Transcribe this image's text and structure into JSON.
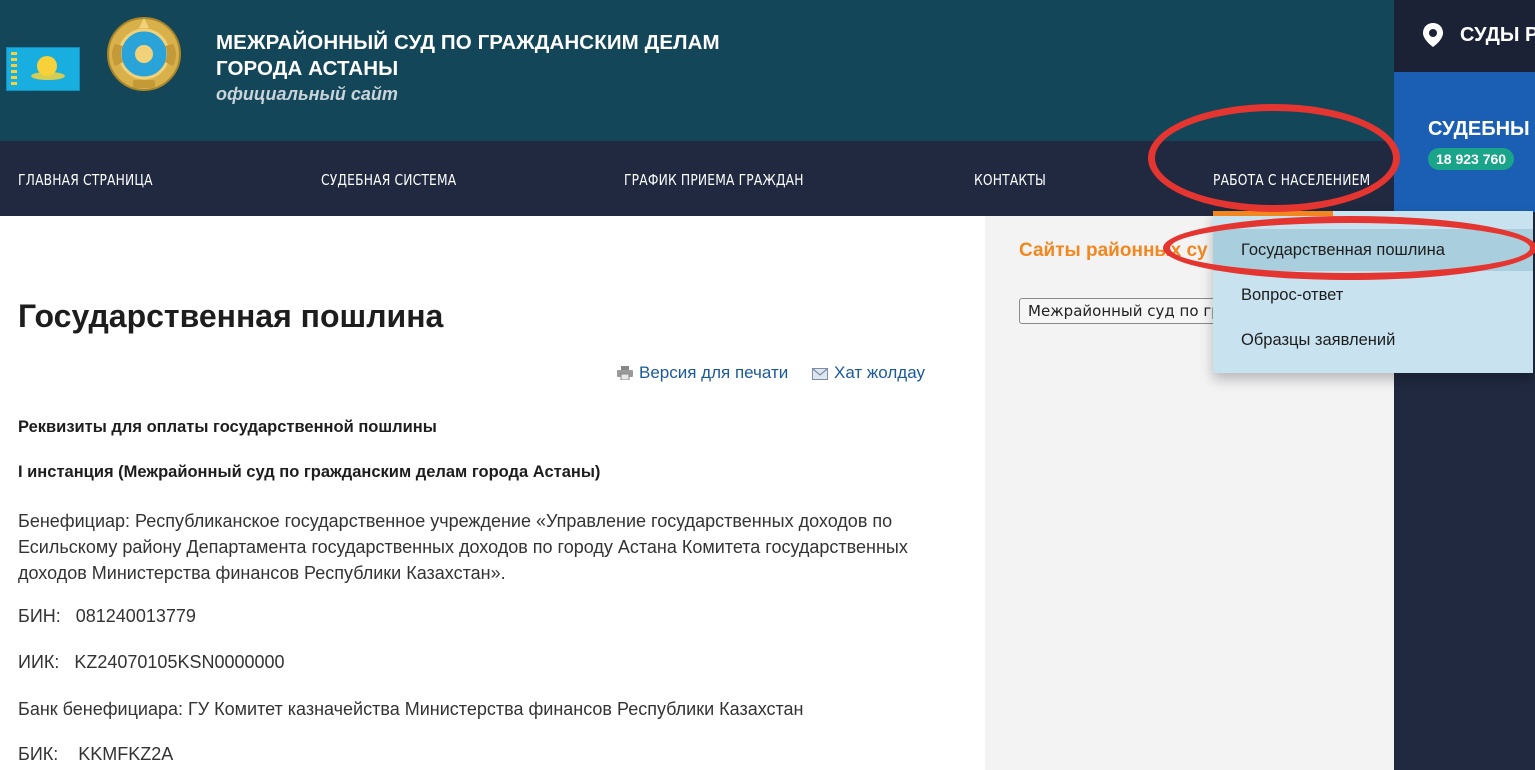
{
  "header": {
    "title_line1": "МЕЖРАЙОННЫЙ СУД ПО ГРАЖДАНСКИМ ДЕЛАМ",
    "title_line2": "ГОРОДА АСТАНЫ",
    "subtitle": "официальный сайт",
    "brand_color": "#134658"
  },
  "nav": {
    "items": [
      "ГЛАВНАЯ СТРАНИЦА",
      "СУДЕБНАЯ СИСТЕМА",
      "ГРАФИК ПРИЕМА ГРАЖДАН",
      "КОНТАКТЫ",
      "РАБОТА С НАСЕЛЕНИЕМ"
    ]
  },
  "dropdown": {
    "items": [
      "Государственная пошлина",
      "Вопрос-ответ",
      "Образцы заявлений"
    ],
    "active_index": 0
  },
  "right_panel": {
    "courts_label": "СУДЫ Р",
    "blue_title": "СУДЕБНЫ",
    "counter": "18 923 760"
  },
  "sidebar": {
    "heading": "Сайты районных су",
    "select_value": "Межрайонный суд по гражданским делам"
  },
  "main": {
    "page_title": "Государственная пошлина",
    "print_link": "Версия для печати",
    "send_link": "Хат жолдау",
    "paragraphs": [
      "Реквизиты для оплаты государственной пошлины",
      "I инстанция (Межрайонный суд по гражданским делам города Астаны)",
      "Бенефициар: Республиканское государственное учреждение «Управление государственных доходов по Есильскому району Департамента государственных доходов по городу Астана Комитета государственных доходов Министерства финансов Республики Казахстан».",
      "БИН:   081240013779",
      "ИИК:   KZ24070105KSN0000000",
      "Банк бенефициара: ГУ Комитет казначейства Министерства финансов Республики Казахстан",
      "БИК:    KKMFKZ2A"
    ]
  }
}
